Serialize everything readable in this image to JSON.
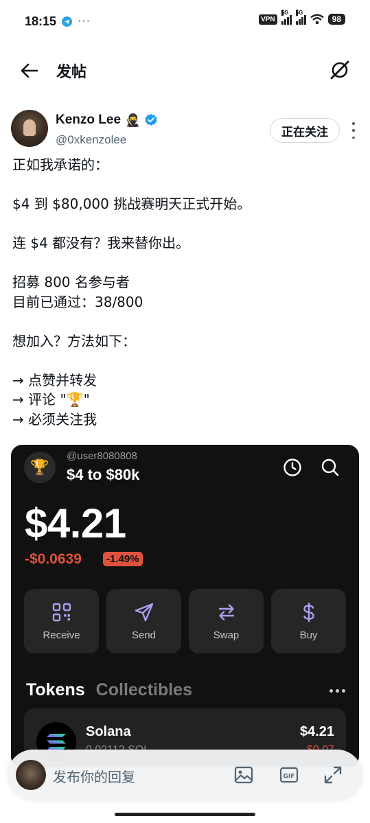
{
  "status_bar": {
    "time": "18:15",
    "dots": "···",
    "vpn": "VPN",
    "net1": "5G",
    "net2": "5G",
    "battery": "98"
  },
  "header": {
    "title": "发帖"
  },
  "author": {
    "name": "Kenzo Lee",
    "emoji": "🥷",
    "handle": "@0xkenzolee",
    "follow_label": "正在关注"
  },
  "post": {
    "text": "正如我承诺的：\n\n$4 到 $80,000 挑战赛明天正式开始。\n\n连 $4 都没有？我来替你出。\n\n招募 800 名参与者\n目前已通过：38/800\n\n想加入？方法如下：\n\n→ 点赞并转发\n→ 评论 \"🏆\"\n→ 必须关注我"
  },
  "card": {
    "trophy": "🏆",
    "user": "@user8080808",
    "wallet_name": "$4 to $80k",
    "balance": "$4.21",
    "change_abs": "-$0.0639",
    "change_pct": "-1.49%",
    "actions": [
      {
        "label": "Receive",
        "icon": "qr-code-icon"
      },
      {
        "label": "Send",
        "icon": "send-icon"
      },
      {
        "label": "Swap",
        "icon": "swap-icon"
      },
      {
        "label": "Buy",
        "icon": "dollar-icon"
      }
    ],
    "tabs": {
      "active": "Tokens",
      "inactive": "Collectibles"
    },
    "token": {
      "name": "Solana",
      "amount": "0.02112 SOL",
      "value": "$4.21",
      "change": "-$0.07"
    },
    "accent_color": "#ab9ff2",
    "negative_color": "#e0523d"
  },
  "reply": {
    "placeholder": "发布你的回复"
  }
}
